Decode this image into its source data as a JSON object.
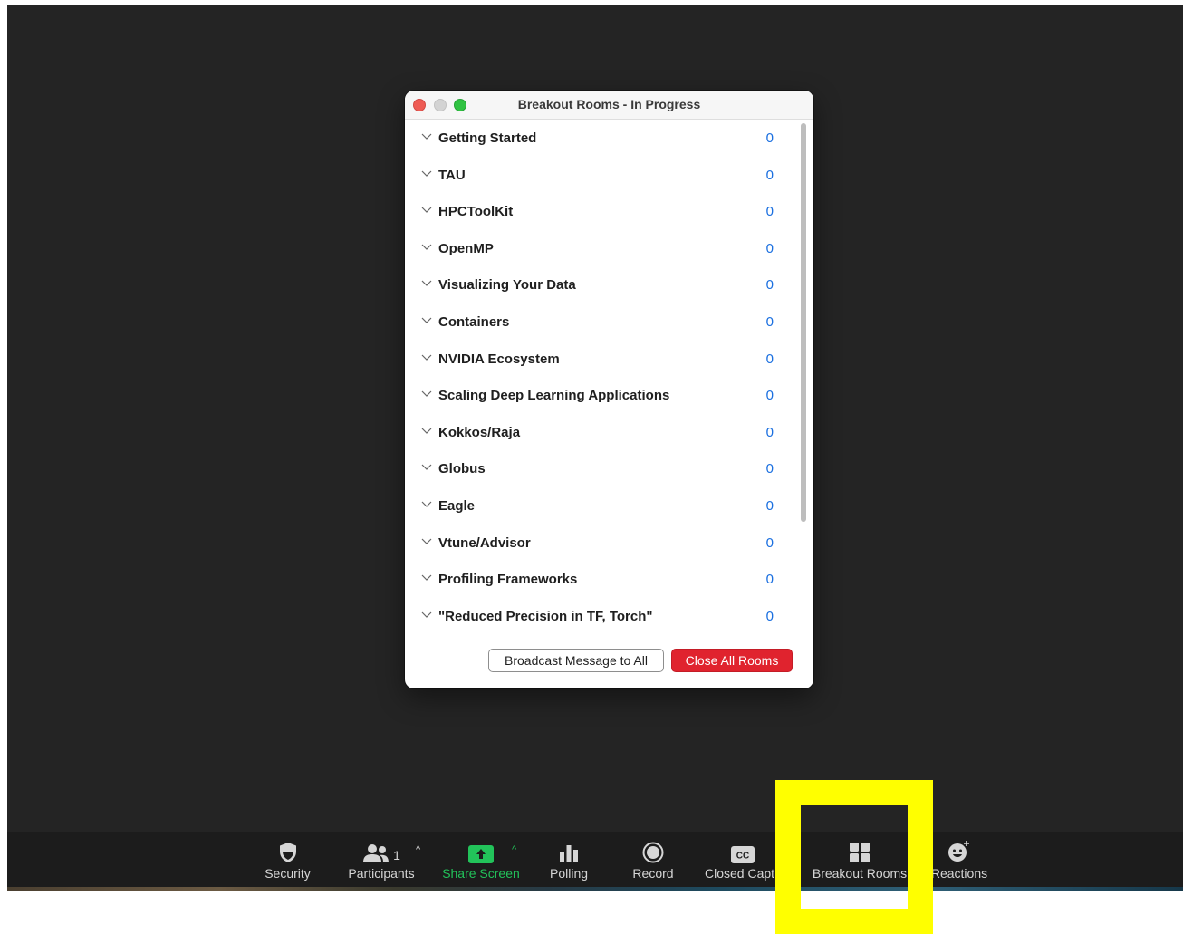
{
  "dialog": {
    "title": "Breakout Rooms - In Progress",
    "rooms": [
      {
        "name": "Getting Started",
        "count": "0"
      },
      {
        "name": "TAU",
        "count": "0"
      },
      {
        "name": "HPCToolKit",
        "count": "0"
      },
      {
        "name": "OpenMP",
        "count": "0"
      },
      {
        "name": "Visualizing Your Data",
        "count": "0"
      },
      {
        "name": "Containers",
        "count": "0"
      },
      {
        "name": "NVIDIA Ecosystem",
        "count": "0"
      },
      {
        "name": "Scaling Deep Learning Applications",
        "count": "0"
      },
      {
        "name": "Kokkos/Raja",
        "count": "0"
      },
      {
        "name": "Globus",
        "count": "0"
      },
      {
        "name": "Eagle",
        "count": "0"
      },
      {
        "name": "Vtune/Advisor",
        "count": "0"
      },
      {
        "name": "Profiling Frameworks",
        "count": "0"
      },
      {
        "name": "\"Reduced Precision in TF, Torch\"",
        "count": "0"
      }
    ],
    "broadcast_label": "Broadcast Message to All",
    "close_label": "Close All Rooms"
  },
  "toolbar": {
    "security": "Security",
    "participants": "Participants",
    "participants_count": "1",
    "share": "Share Screen",
    "polling": "Polling",
    "record": "Record",
    "captions": "Closed Capt",
    "breakout": "Breakout Rooms",
    "reactions": "Reactions"
  },
  "colors": {
    "accent_blue": "#1a6fe0",
    "close_red": "#e0232e",
    "share_green": "#22c35a",
    "highlight": "#ffff00"
  }
}
